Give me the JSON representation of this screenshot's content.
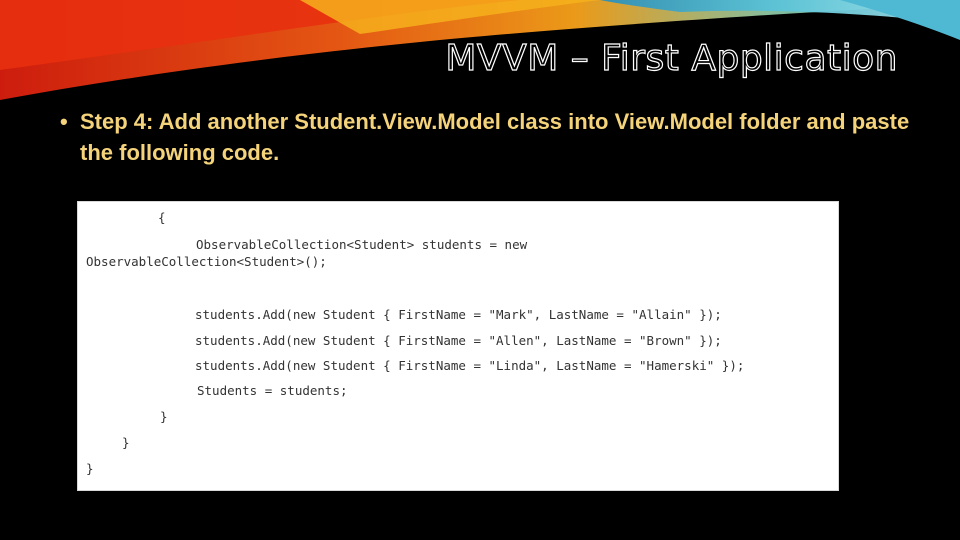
{
  "slide": {
    "title": "MVVM – First Application",
    "bullet_marker": "•",
    "bullet_text": "Step 4: Add another Student.View.Model class into View.Model folder and paste the following code."
  },
  "code": {
    "lines": [
      "{",
      "ObservableCollection<Student> students = new",
      "ObservableCollection<Student>();",
      "students.Add(new Student { FirstName = \"Mark\", LastName = \"Allain\" });",
      "students.Add(new Student { FirstName = \"Allen\", LastName = \"Brown\" });",
      "students.Add(new Student { FirstName = \"Linda\", LastName = \"Hamerski\" });",
      "Students = students;",
      "}",
      "}",
      "}"
    ]
  },
  "colors": {
    "background": "#000000",
    "bullet_text": "#f4d37a",
    "title_outline": "#ffffff",
    "code_text": "#333333",
    "swoosh_red": "#e32b12",
    "swoosh_orange": "#f59a16",
    "swoosh_teal": "#39a9c9"
  }
}
